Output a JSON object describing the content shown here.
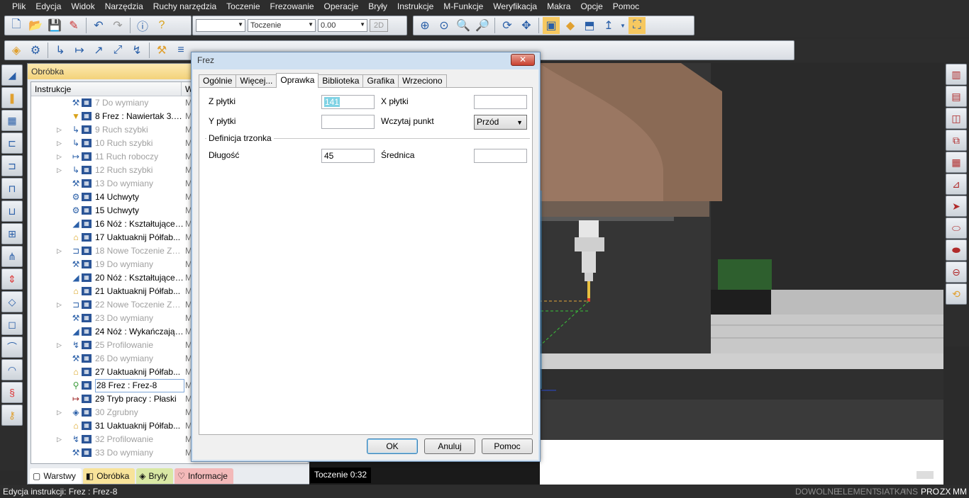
{
  "menu": [
    "Plik",
    "Edycja",
    "Widok",
    "Narzędzia",
    "Ruchy narzędzia",
    "Toczenie",
    "Frezowanie",
    "Operacje",
    "Bryły",
    "Instrukcje",
    "M-Funkcje",
    "Weryfikacja",
    "Makra",
    "Opcje",
    "Pomoc"
  ],
  "toolbar": {
    "combo1": "",
    "combo2": "Toczenie",
    "combo3": "0.00",
    "mode_2d": "2D"
  },
  "panel": {
    "title": "Obróbka",
    "col_instr": "Instrukcje",
    "col_w": "W"
  },
  "tree": [
    {
      "label": "7 Do wymiany",
      "col2": "M",
      "dim": true,
      "expander": false,
      "icon": "tool-change-icon"
    },
    {
      "label": "8 Frez : Nawiertak 3.1...",
      "col2": "M",
      "dim": false,
      "expander": false,
      "icon": "drill-icon"
    },
    {
      "label": "9 Ruch szybki",
      "col2": "M",
      "dim": true,
      "expander": true,
      "icon": "rapid-move-icon"
    },
    {
      "label": "10 Ruch szybki",
      "col2": "M",
      "dim": true,
      "expander": true,
      "icon": "rapid-move-icon"
    },
    {
      "label": "11 Ruch roboczy",
      "col2": "M",
      "dim": true,
      "expander": true,
      "icon": "feed-move-icon"
    },
    {
      "label": "12 Ruch szybki",
      "col2": "M",
      "dim": true,
      "expander": true,
      "icon": "rapid-move-icon"
    },
    {
      "label": "13 Do wymiany",
      "col2": "M",
      "dim": true,
      "expander": false,
      "icon": "tool-change-icon"
    },
    {
      "label": "14 Uchwyty",
      "col2": "M",
      "dim": false,
      "expander": false,
      "icon": "chuck-icon"
    },
    {
      "label": "15 Uchwyty",
      "col2": "M",
      "dim": false,
      "expander": false,
      "icon": "chuck-icon"
    },
    {
      "label": "16 Nóż : Kształtujące-...",
      "col2": "M",
      "dim": false,
      "expander": false,
      "icon": "knife-icon"
    },
    {
      "label": "17 Uaktuaknij Półfab...",
      "col2": "M",
      "dim": false,
      "expander": false,
      "icon": "stock-update-icon"
    },
    {
      "label": "18 Nowe Toczenie Zg...",
      "col2": "M",
      "dim": true,
      "expander": true,
      "icon": "turning-icon"
    },
    {
      "label": "19 Do wymiany",
      "col2": "M",
      "dim": true,
      "expander": false,
      "icon": "tool-change-icon"
    },
    {
      "label": "20 Nóż : Kształtujące-...",
      "col2": "M",
      "dim": false,
      "expander": false,
      "icon": "knife-icon"
    },
    {
      "label": "21 Uaktuaknij Półfab...",
      "col2": "M",
      "dim": false,
      "expander": false,
      "icon": "stock-update-icon"
    },
    {
      "label": "22 Nowe Toczenie Zg...",
      "col2": "M",
      "dim": true,
      "expander": true,
      "icon": "turning-icon"
    },
    {
      "label": "23 Do wymiany",
      "col2": "M",
      "dim": true,
      "expander": false,
      "icon": "tool-change-icon"
    },
    {
      "label": "24 Nóż : Wykańczając...",
      "col2": "M",
      "dim": false,
      "expander": false,
      "icon": "knife-icon"
    },
    {
      "label": "25 Profilowanie",
      "col2": "M",
      "dim": true,
      "expander": true,
      "icon": "profile-icon"
    },
    {
      "label": "26 Do wymiany",
      "col2": "M",
      "dim": true,
      "expander": false,
      "icon": "tool-change-icon"
    },
    {
      "label": "27 Uaktuaknij Półfab...",
      "col2": "M",
      "dim": false,
      "expander": false,
      "icon": "stock-update-icon"
    },
    {
      "label": "28 Frez : Frez-8",
      "col2": "M",
      "dim": false,
      "expander": false,
      "icon": "mill-icon",
      "selected": true
    },
    {
      "label": "29 Tryb pracy : Płaski",
      "col2": "M",
      "dim": false,
      "expander": false,
      "icon": "mode-icon"
    },
    {
      "label": "30 Zgrubny",
      "col2": "M",
      "dim": true,
      "expander": true,
      "icon": "roughing-icon"
    },
    {
      "label": "31 Uaktuaknij Półfab...",
      "col2": "M",
      "dim": false,
      "expander": false,
      "icon": "stock-update-icon"
    },
    {
      "label": "32 Profilowanie",
      "col2": "M",
      "dim": true,
      "expander": true,
      "icon": "profile-icon"
    },
    {
      "label": "33 Do wymiany",
      "col2": "M",
      "dim": true,
      "expander": false,
      "icon": "tool-change-icon"
    }
  ],
  "tabs": [
    {
      "label": "Warstwy",
      "color": "#ffffff"
    },
    {
      "label": "Obróbka",
      "color": "#f8e39a"
    },
    {
      "label": "Bryły",
      "color": "#d9e8a4"
    },
    {
      "label": "Informacje",
      "color": "#f3b9b9"
    }
  ],
  "viewport": {
    "caption": "Toczenie 0:32"
  },
  "status": {
    "text": "Edycja instrukcji:  Frez : Frez-8",
    "indicators": [
      {
        "label": "DOWOLNE",
        "on": false
      },
      {
        "label": "ELEMENT",
        "on": false
      },
      {
        "label": "SIATKA",
        "on": false
      },
      {
        "label": "INS",
        "on": false
      },
      {
        "label": "PRO",
        "on": true
      },
      {
        "label": "ZX",
        "on": true
      },
      {
        "label": "MM",
        "on": true
      }
    ]
  },
  "dialog": {
    "title": "Frez",
    "close": "✕",
    "tabs": [
      "Ogólnie",
      "Więcej...",
      "Oprawka",
      "Biblioteka",
      "Grafika",
      "Wrzeciono"
    ],
    "active_tab": "Oprawka",
    "z_label": "Z płytki",
    "z_value": "141",
    "x_label": "X płytki",
    "x_value": "",
    "y_label": "Y płytki",
    "y_value": "",
    "load_label": "Wczytaj punkt",
    "load_value": "Przód",
    "section": "Definicja trzonka",
    "length_label": "Długość",
    "length_value": "45",
    "diameter_label": "Średnica",
    "diameter_value": "",
    "ok": "OK",
    "cancel": "Anuluj",
    "help": "Pomoc"
  },
  "colors": {
    "accent_panel": "#f3d27a",
    "dialog_frame": "#cfe0f1",
    "close_button": "#c9412f"
  }
}
